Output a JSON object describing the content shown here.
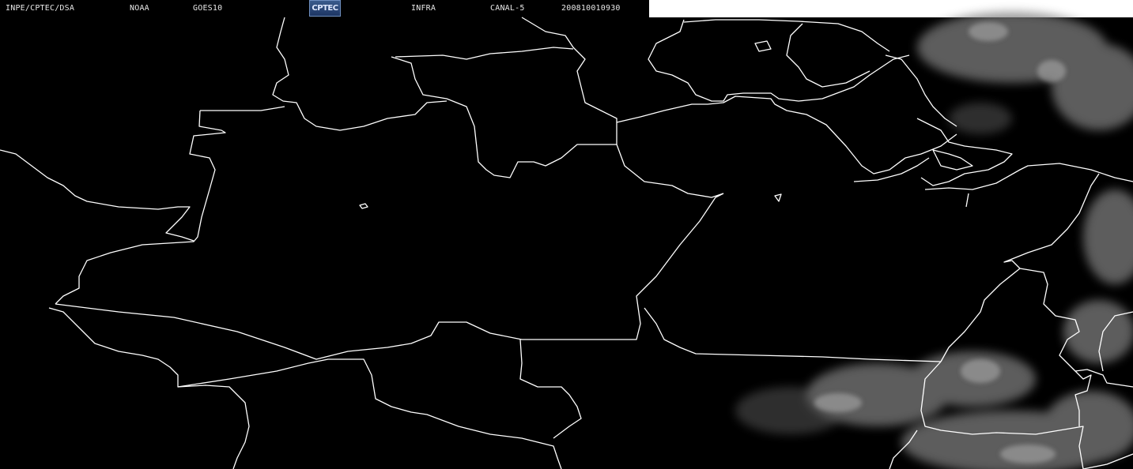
{
  "header": {
    "institution": "INPE/CPTEC/DSA",
    "agency": "NOAA",
    "satellite": "GOES10",
    "logo_text": "CPTEC",
    "product": "INFRA",
    "channel": "CANAL-5",
    "timestamp": "200810010930"
  },
  "map": {
    "background_color": "#000000",
    "border_color": "#ffffff",
    "cloud_color": "#8a8a8a"
  }
}
